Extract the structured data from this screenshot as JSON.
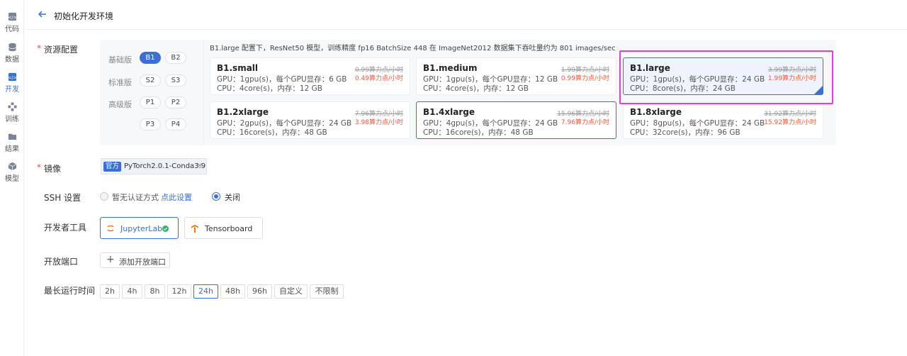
{
  "sidebar": {
    "items": [
      {
        "label": "代码",
        "icon": "code-icon"
      },
      {
        "label": "数据",
        "icon": "database-icon"
      },
      {
        "label": "开发",
        "icon": "dev-icon"
      },
      {
        "label": "训练",
        "icon": "train-icon"
      },
      {
        "label": "结果",
        "icon": "folder-icon"
      },
      {
        "label": "模型",
        "icon": "cube-icon"
      }
    ]
  },
  "header": {
    "title": "初始化开发环境"
  },
  "resource": {
    "label": "资源配置",
    "tiers": {
      "basic": "基础版",
      "standard": "标准版",
      "advanced": "高级版"
    },
    "pills": {
      "b1": "B1",
      "b2": "B2",
      "s2": "S2",
      "s3": "S3",
      "p1": "P1",
      "p2": "P2",
      "p3": "P3",
      "p4": "P4"
    },
    "hint": "B1.large 配置下，ResNet50 模型，训练精度 fp16 BatchSize 448 在 ImageNet2012 数据集下吞吐量约为 801 images/sec",
    "cards": [
      {
        "name": "B1.small",
        "gpu": "GPU：1gpu(s)，每个GPU显存：6 GB",
        "cpu": "CPU：4core(s)，内存：12 GB",
        "old": "0.99算力点/小时",
        "new": "0.49算力点/小时"
      },
      {
        "name": "B1.medium",
        "gpu": "GPU：1gpu(s)，每个GPU显存：12 GB",
        "cpu": "CPU：4core(s)，内存：12 GB",
        "old": "1.99算力点/小时",
        "new": "0.99算力点/小时"
      },
      {
        "name": "B1.large",
        "gpu": "GPU：1gpu(s)，每个GPU显存：24 GB",
        "cpu": "CPU：8core(s)，内存：24 GB",
        "old": "3.99算力点/小时",
        "new": "1.99算力点/小时"
      },
      {
        "name": "B1.2xlarge",
        "gpu": "GPU：2gpu(s)，每个GPU显存：24 GB",
        "cpu": "CPU：16core(s)，内存：48 GB",
        "old": "7.96算力点/小时",
        "new": "3.98算力点/小时"
      },
      {
        "name": "B1.4xlarge",
        "gpu": "GPU：4gpu(s)，每个GPU显存：24 GB",
        "cpu": "CPU：16core(s)，内存：48 GB",
        "old": "15.96算力点/小时",
        "new": "7.96算力点/小时"
      },
      {
        "name": "B1.8xlarge",
        "gpu": "GPU：8gpu(s)，每个GPU显存：24 GB",
        "cpu": "CPU：32core(s)，内存：96 GB",
        "old": "31.92算力点/小时",
        "new": "15.92算力点/小时"
      }
    ]
  },
  "image": {
    "label": "镜像",
    "badge": "官方",
    "value": "PyTorch2.0.1-Conda3.9",
    "remove": "×"
  },
  "ssh": {
    "label": "SSH 设置",
    "opt1": "暂无认证方式",
    "link": "点此设置",
    "opt2": "关闭"
  },
  "tools": {
    "label": "开发者工具",
    "jupyter": "JupyterLab",
    "tensorboard": "Tensorboard"
  },
  "ports": {
    "label": "开放端口",
    "add": "添加开放端口"
  },
  "runtime": {
    "label": "最长运行时间",
    "options": [
      "2h",
      "4h",
      "8h",
      "12h",
      "24h",
      "48h",
      "96h",
      "自定义",
      "不限制"
    ]
  },
  "colors": {
    "accent": "#3b6fd4",
    "price": "#f05a3a",
    "highlight": "#e23ce0"
  }
}
